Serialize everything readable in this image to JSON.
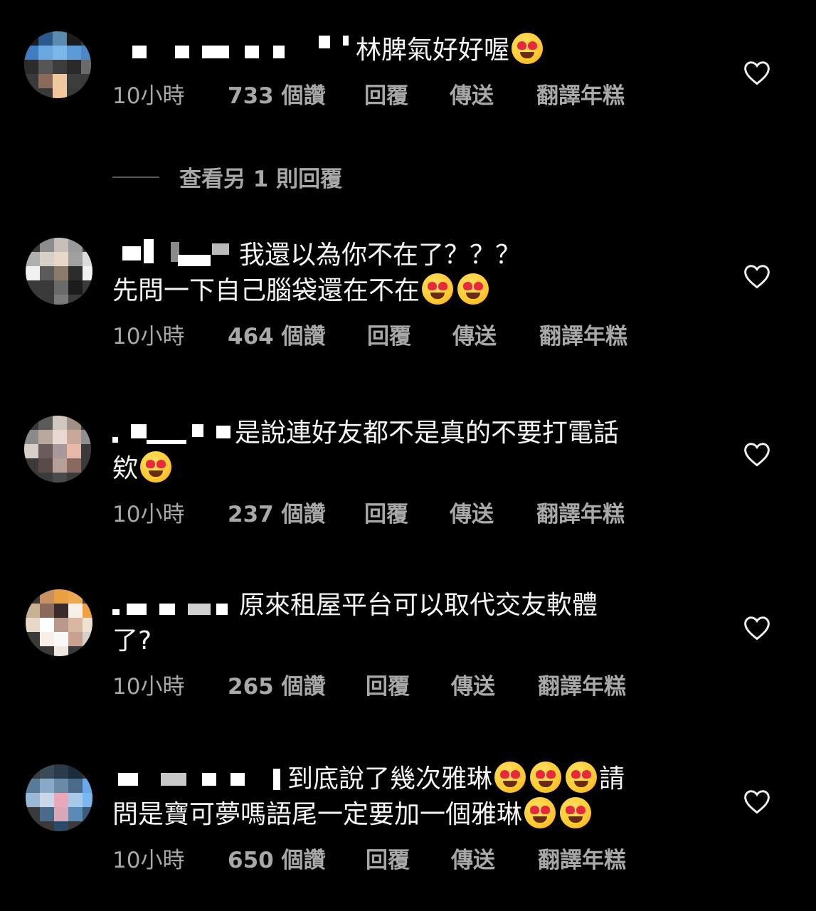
{
  "comments": [
    {
      "text_lines": [
        "林脾氣好好喔"
      ],
      "emoji_after": [
        1
      ],
      "time": "10小時",
      "likes": "733 個讚",
      "reply": "回覆",
      "send": "傳送",
      "translate": "翻譯年糕"
    },
    {
      "text_lines": [
        "我還以為你不在了？？？",
        "先問一下自己腦袋還在不在"
      ],
      "emoji_after": [
        0,
        2
      ],
      "time": "10小時",
      "likes": "464 個讚",
      "reply": "回覆",
      "send": "傳送",
      "translate": "翻譯年糕"
    },
    {
      "text_lines": [
        "是說連好友都不是真的不要打電話",
        "欸"
      ],
      "emoji_after": [
        0,
        1
      ],
      "time": "10小時",
      "likes": "237 個讚",
      "reply": "回覆",
      "send": "傳送",
      "translate": "翻譯年糕"
    },
    {
      "text_lines": [
        "原來租屋平台可以取代交友軟體",
        "了?"
      ],
      "emoji_after": [
        0,
        0
      ],
      "time": "10小時",
      "likes": "265 個讚",
      "reply": "回覆",
      "send": "傳送",
      "translate": "翻譯年糕"
    },
    {
      "text_lines": [
        "到底說了幾次雅琳",
        "請",
        "問是寶可夢嗎語尾一定要加一個雅琳"
      ],
      "emoji_after": [
        3,
        2
      ],
      "time": "10小時",
      "likes": "650 個讚",
      "reply": "回覆",
      "send": "傳送",
      "translate": "翻譯年糕"
    }
  ],
  "view_replies": "查看另 1 則回覆",
  "icons": {
    "like": "heart-outline-icon",
    "reaction": "heart-eyes-emoji"
  },
  "colors": {
    "background": "#000000",
    "text": "#f5f5f5",
    "meta": "#a8a8a8"
  }
}
